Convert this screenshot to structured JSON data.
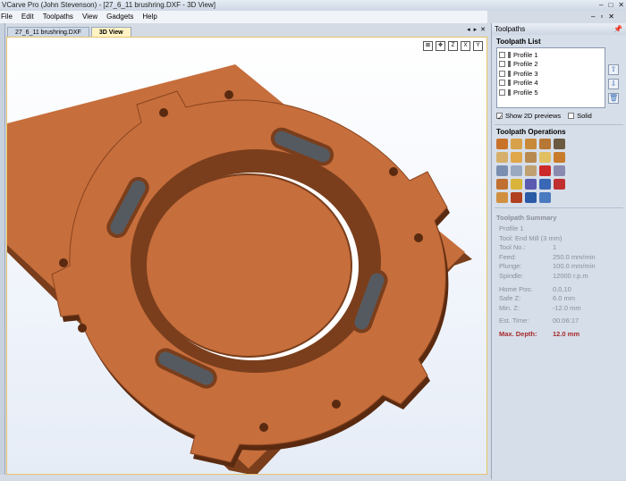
{
  "window": {
    "title": "VCarve Pro (John Stevenson) - [27_6_11 brushring.DXF - 3D View]",
    "minimize": "–",
    "maximize": "□",
    "close": "✕"
  },
  "menu": [
    "File",
    "Edit",
    "Toolpaths",
    "View",
    "Gadgets",
    "Help"
  ],
  "mdi_controls": {
    "min": "–",
    "restore": "▫",
    "close": "✕"
  },
  "tabs": [
    {
      "label": "27_6_11 brushring.DXF"
    },
    {
      "label": "3D View"
    }
  ],
  "tab_nav": {
    "prev": "◂",
    "next": "▸",
    "close": "✕"
  },
  "viewport_tools": [
    "⊠",
    "✥",
    "Z",
    "X",
    "Y"
  ],
  "panel": {
    "title": "Toolpaths",
    "pin": "📌",
    "list_title": "Toolpath List",
    "items": [
      "Profile 1",
      "Profile 2",
      "Profile 3",
      "Profile 4",
      "Profile 5"
    ],
    "side_buttons": [
      "⇧",
      "⇩",
      "🗑"
    ],
    "show_2d_label": "Show 2D previews",
    "solid_label": "Solid",
    "ops_title": "Toolpath Operations",
    "ops_colors": [
      [
        "#c9722a",
        "#d8a24a",
        "#c78a3a",
        "#b77735",
        "#6b5a40"
      ],
      [
        "#d6b06a",
        "#e0a64a",
        "#b98a50",
        "#e0c060",
        "#c87b2a"
      ],
      [
        "#7a8fb0",
        "#9aa8c0",
        "#c0a070",
        "#cc2a2a",
        "#8a8ab0"
      ],
      [
        "#c07030",
        "#d9b43a",
        "#5a5ab0",
        "#3a68b5",
        "#c03030"
      ],
      [
        "#d09040",
        "#b04020",
        "#2a5aa5",
        "#4a7ac0"
      ]
    ]
  },
  "summary": {
    "title": "Toolpath Summary",
    "name": "Profile 1",
    "tool": "Tool: End Mill (3 mm)",
    "rows1": [
      {
        "k": "Tool No.:",
        "v": "1"
      },
      {
        "k": "Feed:",
        "v": "250.0 mm/min"
      },
      {
        "k": "Plunge:",
        "v": "100.0 mm/min"
      },
      {
        "k": "Spindle:",
        "v": "12000 r.p.m"
      }
    ],
    "rows2": [
      {
        "k": "Home Pos:",
        "v": "0,0,10"
      },
      {
        "k": "Safe Z:",
        "v": "6.0 mm"
      },
      {
        "k": "Min. Z:",
        "v": "-12.0 mm"
      }
    ],
    "est_time": {
      "k": "Est. Time:",
      "v": "00:06:17"
    },
    "max_depth": {
      "k": "Max. Depth:",
      "v": "12.0 mm"
    }
  },
  "colors": {
    "wood_top": "#c66e3c",
    "wood_side": "#7a3e1c",
    "wood_dark": "#5a2a10",
    "slot_grey": "#555a60",
    "tab_active": "#fff3c4"
  }
}
